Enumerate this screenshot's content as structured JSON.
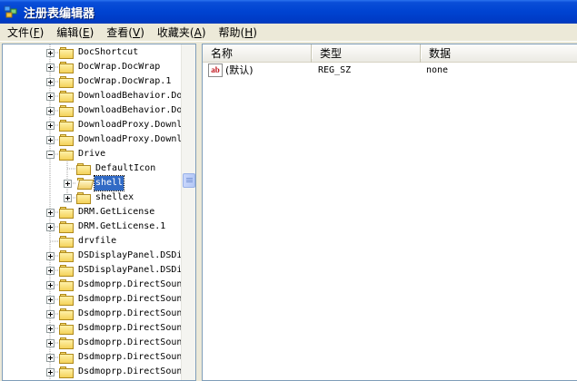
{
  "window": {
    "title": "注册表编辑器"
  },
  "menu": [
    {
      "label": "文件",
      "accel": "F"
    },
    {
      "label": "编辑",
      "accel": "E"
    },
    {
      "label": "查看",
      "accel": "V"
    },
    {
      "label": "收藏夹",
      "accel": "A"
    },
    {
      "label": "帮助",
      "accel": "H"
    }
  ],
  "tree": {
    "nodes": [
      {
        "label": "DocShortcut",
        "level": 0,
        "expander": "plus"
      },
      {
        "label": "DocWrap.DocWrap",
        "level": 0,
        "expander": "plus"
      },
      {
        "label": "DocWrap.DocWrap.1",
        "level": 0,
        "expander": "plus"
      },
      {
        "label": "DownloadBehavior.Do",
        "level": 0,
        "expander": "plus"
      },
      {
        "label": "DownloadBehavior.Do",
        "level": 0,
        "expander": "plus"
      },
      {
        "label": "DownloadProxy.Downl",
        "level": 0,
        "expander": "plus"
      },
      {
        "label": "DownloadProxy.Downl",
        "level": 0,
        "expander": "plus"
      },
      {
        "label": "Drive",
        "level": 0,
        "expander": "minus"
      },
      {
        "label": "DefaultIcon",
        "level": 1,
        "expander": "none"
      },
      {
        "label": "shell",
        "level": 1,
        "expander": "plus",
        "selected": true,
        "open": true
      },
      {
        "label": "shellex",
        "level": 1,
        "expander": "plus"
      },
      {
        "label": "DRM.GetLicense",
        "level": 0,
        "expander": "plus"
      },
      {
        "label": "DRM.GetLicense.1",
        "level": 0,
        "expander": "plus"
      },
      {
        "label": "drvfile",
        "level": 0,
        "expander": "none"
      },
      {
        "label": "DSDisplayPanel.DSDi",
        "level": 0,
        "expander": "plus"
      },
      {
        "label": "DSDisplayPanel.DSDi",
        "level": 0,
        "expander": "plus"
      },
      {
        "label": "Dsdmoprp.DirectSoun",
        "level": 0,
        "expander": "plus"
      },
      {
        "label": "Dsdmoprp.DirectSoun",
        "level": 0,
        "expander": "plus"
      },
      {
        "label": "Dsdmoprp.DirectSoun",
        "level": 0,
        "expander": "plus"
      },
      {
        "label": "Dsdmoprp.DirectSoun",
        "level": 0,
        "expander": "plus"
      },
      {
        "label": "Dsdmoprp.DirectSoun",
        "level": 0,
        "expander": "plus"
      },
      {
        "label": "Dsdmoprp.DirectSoun",
        "level": 0,
        "expander": "plus"
      },
      {
        "label": "Dsdmoprp.DirectSoun",
        "level": 0,
        "expander": "plus"
      }
    ]
  },
  "list": {
    "columns": [
      "名称",
      "类型",
      "数据"
    ],
    "rows": [
      {
        "icon": "ab",
        "name": "(默认)",
        "type": "REG_SZ",
        "data": "none"
      }
    ]
  },
  "icons": {
    "app": "registry-editor-icon",
    "folder": "folder-icon",
    "value": "string-value-icon"
  },
  "colors": {
    "titlebar": "#0043d1",
    "selection": "#316ac5",
    "value_icon_text": "#c0131b"
  }
}
